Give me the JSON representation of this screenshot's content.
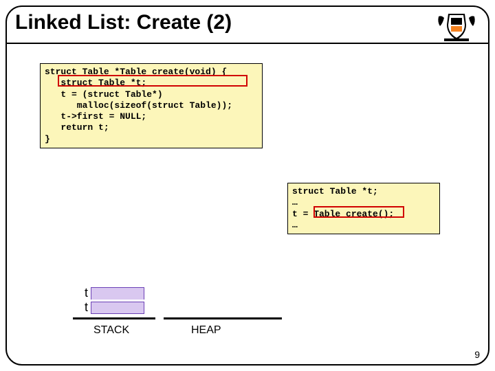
{
  "title": "Linked List: Create (2)",
  "code1": {
    "l1": "struct Table *Table_create(void) {",
    "l2": "   struct Table *t;",
    "l3": "   t = (struct Table*)",
    "l4": "      malloc(sizeof(struct Table));",
    "l5": "   t->first = NULL;",
    "l6": "   return t;",
    "l7": "}"
  },
  "code2": {
    "l1": "struct Table *t;",
    "l2": "…",
    "l3": "t = Table_create();",
    "l4": "…"
  },
  "stack": {
    "row1": "t",
    "row2": "t"
  },
  "regions": {
    "stack": "STACK",
    "heap": "HEAP"
  },
  "pagenum": "9"
}
